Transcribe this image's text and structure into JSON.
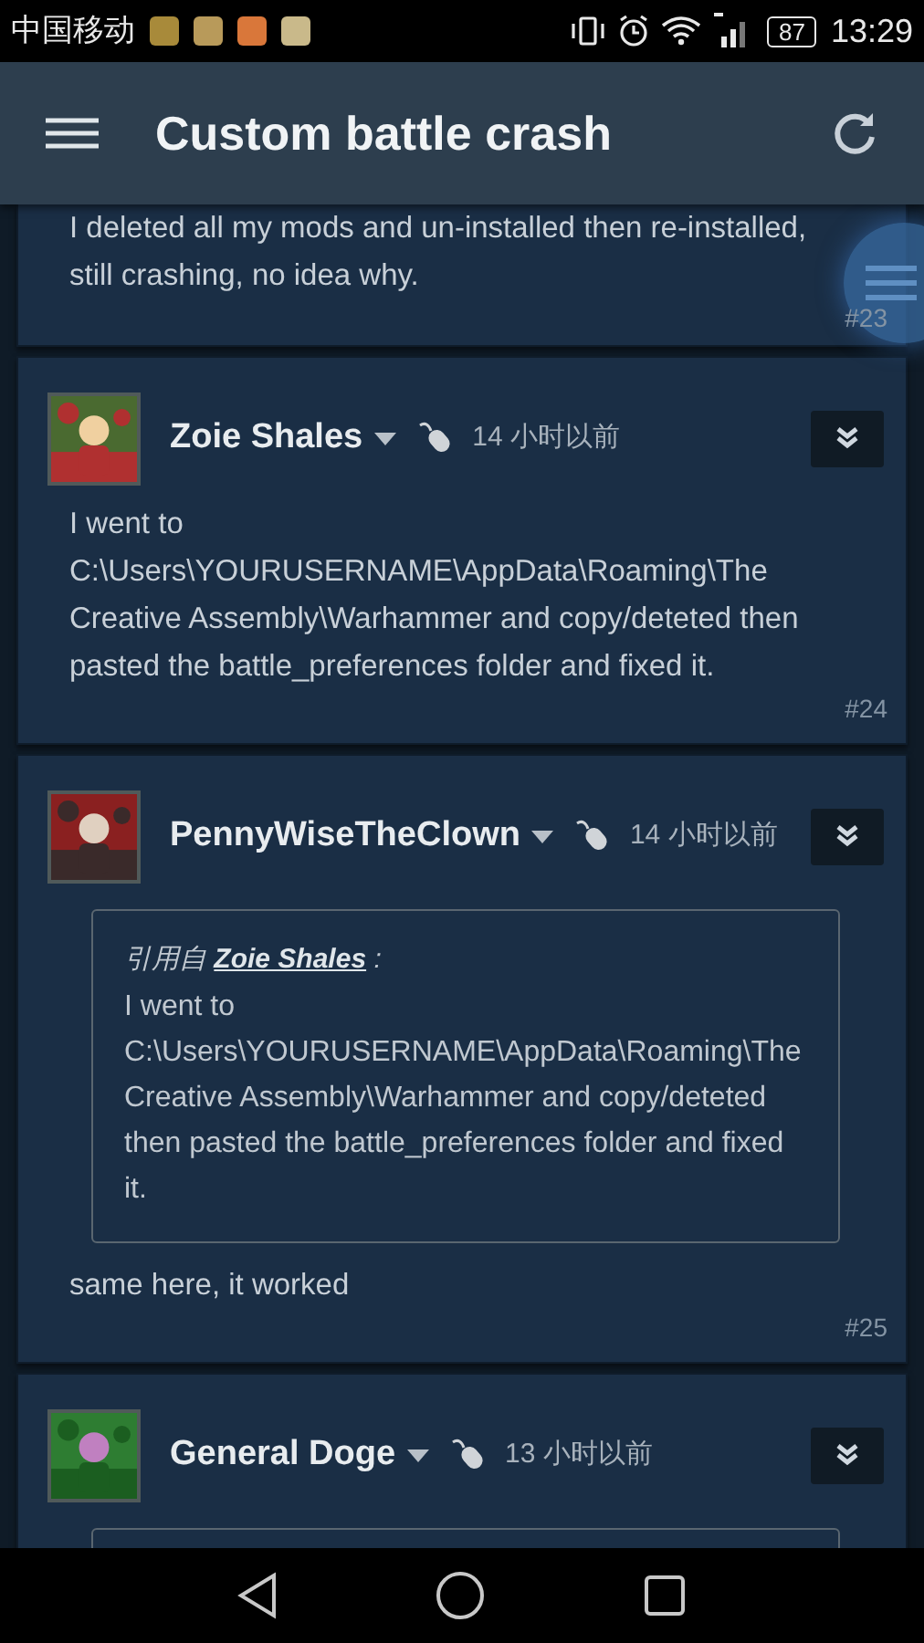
{
  "status_bar": {
    "carrier": "中国移动",
    "notification_icons": [
      {
        "color": "#a88a3a"
      },
      {
        "color": "#b89a5a"
      },
      {
        "color": "#d9773a"
      },
      {
        "color": "#c9b98a"
      }
    ],
    "battery": "87",
    "time": "13:29"
  },
  "app_bar": {
    "title": "Custom battle crash"
  },
  "posts": [
    {
      "kind": "continued",
      "body": "I deleted all my mods and un-installed then re-installed, still crashing, no idea why.",
      "number": "#23"
    },
    {
      "kind": "full",
      "author": "Zoie Shales",
      "time": "14 小时以前",
      "body": "I went to C:\\Users\\YOURUSERNAME\\AppData\\Roaming\\The Creative Assembly\\Warhammer and copy/deteted then pasted the battle_preferences folder and fixed it.",
      "number": "#24"
    },
    {
      "kind": "full",
      "author": "PennyWiseTheClown",
      "time": "14 小时以前",
      "quote": {
        "kind": "full",
        "prefix": "引用自",
        "author": "Zoie Shales",
        "suffix": ":",
        "text": "I went to C:\\Users\\YOURUSERNAME\\AppData\\Roaming\\The Creative Assembly\\Warhammer and copy/deteted then pasted the battle_preferences folder and fixed it."
      },
      "body": "same here, it worked",
      "number": "#25"
    },
    {
      "kind": "full",
      "author": "General Doge",
      "time": "13 小时以前",
      "quote": {
        "kind": "cut_off"
      }
    }
  ]
}
